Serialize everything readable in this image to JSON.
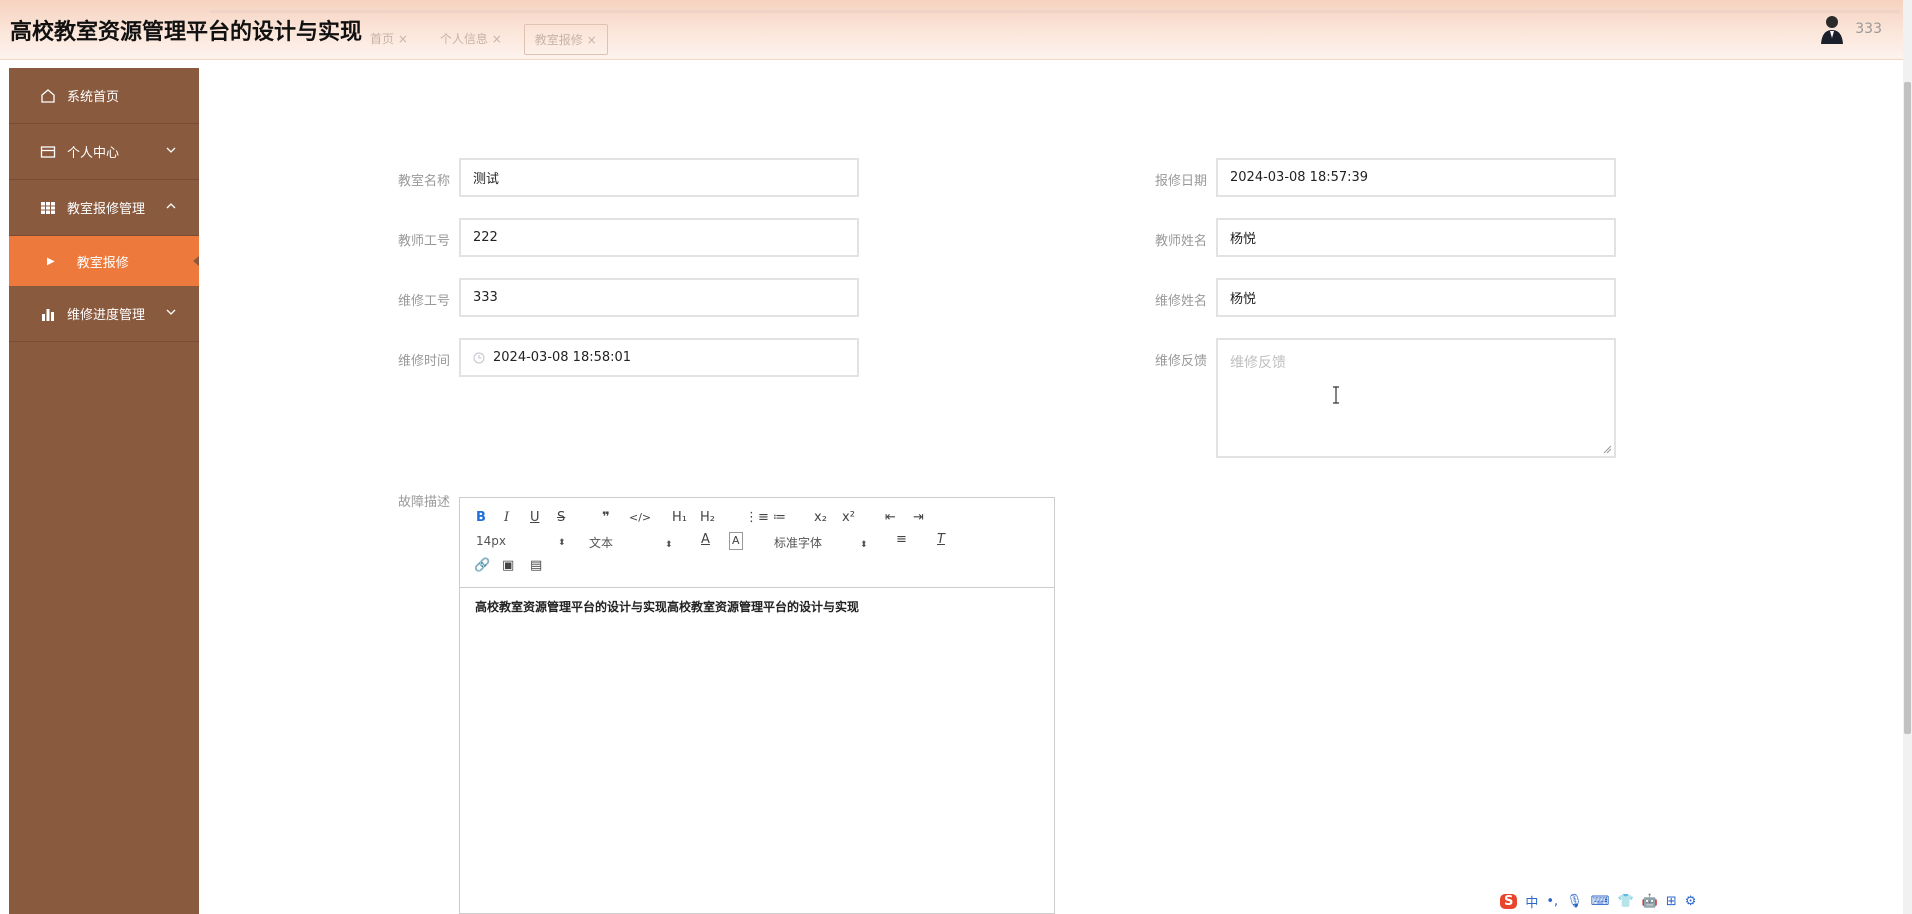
{
  "header": {
    "site_title": "高校教室资源管理平台的设计与实现",
    "tabs": [
      "首页 ×",
      "个人信息 ×",
      "教室报修 ×"
    ],
    "username": "333"
  },
  "sidebar": {
    "items": [
      {
        "label": "系统首页",
        "icon": "home-icon"
      },
      {
        "label": "个人中心",
        "icon": "card-icon",
        "chevron": "down"
      },
      {
        "label": "教室报修管理",
        "icon": "grid-icon",
        "chevron": "up"
      },
      {
        "label": "教室报修",
        "submenu": true,
        "active": true
      },
      {
        "label": "维修进度管理",
        "icon": "bar-chart-icon",
        "chevron": "down"
      }
    ]
  },
  "form": {
    "classroom_name": {
      "label": "教室名称",
      "value": "测试"
    },
    "repair_date": {
      "label": "报修日期",
      "value": "2024-03-08 18:57:39"
    },
    "teacher_id": {
      "label": "教师工号",
      "value": "222"
    },
    "teacher_name": {
      "label": "教师姓名",
      "value": "杨悦"
    },
    "repairer_id": {
      "label": "维修工号",
      "value": "333"
    },
    "repairer_name": {
      "label": "维修姓名",
      "value": "杨悦"
    },
    "repair_time": {
      "label": "维修时间",
      "value": "2024-03-08 18:58:01"
    },
    "feedback": {
      "label": "维修反馈",
      "placeholder": "维修反馈"
    },
    "fault_description": {
      "label": "故障描述",
      "content": "高校教室资源管理平台的设计与实现高校教室资源管理平台的设计与实现"
    }
  },
  "editor": {
    "font_size": "14px",
    "block_type": "文本",
    "font_family": "标准字体"
  },
  "colors": {
    "sidebar_bg": "#8a5a3e",
    "active_item": "#ed7a3c",
    "header_gradient_top": "#f6d2c0"
  }
}
